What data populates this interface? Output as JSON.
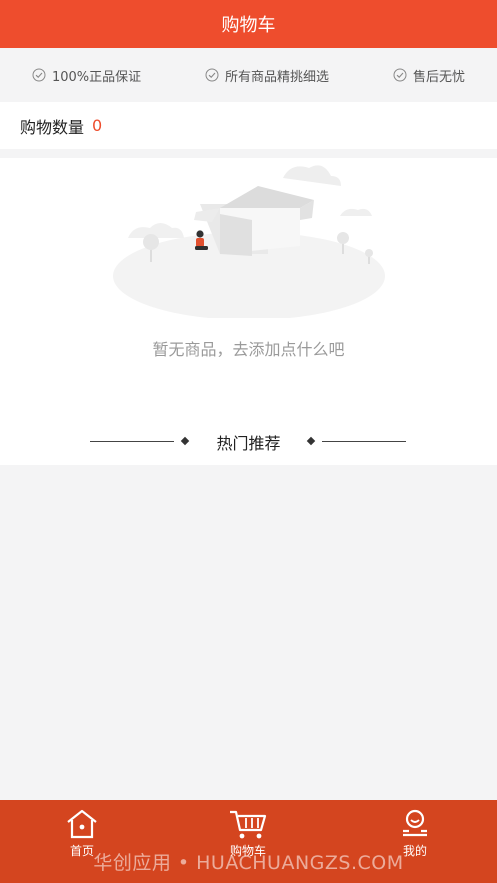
{
  "header": {
    "title": "购物车"
  },
  "guarantees": [
    {
      "label": "100%正品保证",
      "icon": "check-circle-icon"
    },
    {
      "label": "所有商品精挑细选",
      "icon": "check-circle-icon"
    },
    {
      "label": "售后无忧",
      "icon": "check-circle-icon"
    }
  ],
  "cart": {
    "count_label": "购物数量",
    "count": "0"
  },
  "empty": {
    "message": "暂无商品，去添加点什么吧"
  },
  "recommend": {
    "title": "热门推荐"
  },
  "tabs": [
    {
      "label": "首页",
      "icon": "home-icon"
    },
    {
      "label": "购物车",
      "icon": "cart-icon"
    },
    {
      "label": "我的",
      "icon": "user-icon"
    }
  ],
  "watermark": "华创应用 • HUACHUANGZS.COM",
  "colors": {
    "accent": "#ee4d2d",
    "tabbar": "#d4451f"
  }
}
